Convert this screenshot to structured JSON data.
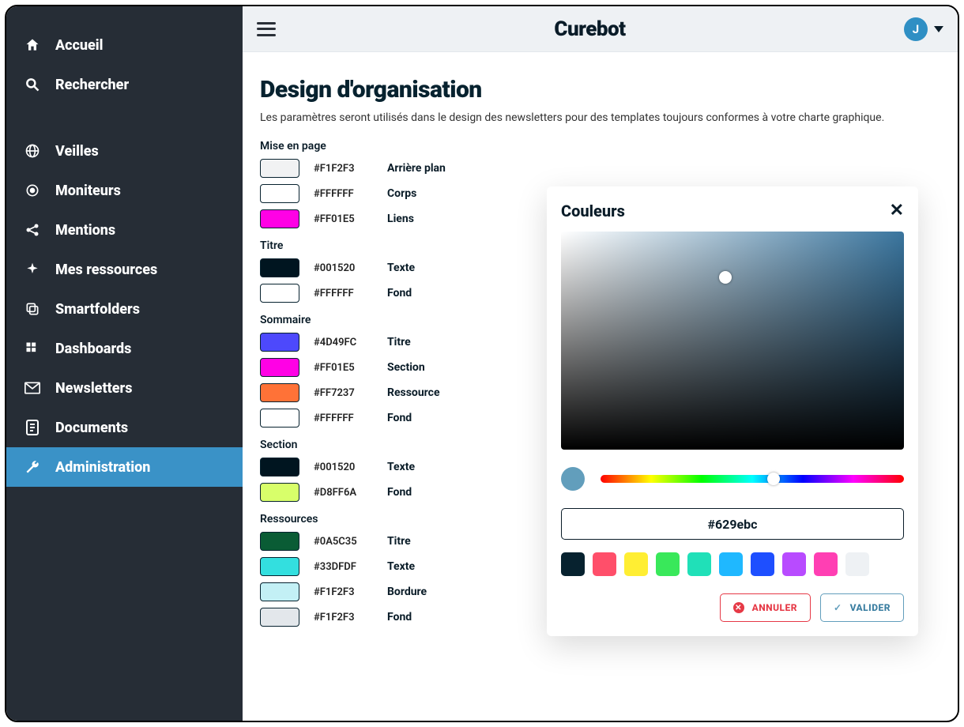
{
  "brand": "Curebot",
  "user_initial": "J",
  "nav": {
    "primary": [
      {
        "id": "home",
        "label": "Accueil"
      },
      {
        "id": "search",
        "label": "Rechercher"
      }
    ],
    "secondary": [
      {
        "id": "veilles",
        "label": "Veilles"
      },
      {
        "id": "moniteurs",
        "label": "Moniteurs"
      },
      {
        "id": "mentions",
        "label": "Mentions"
      },
      {
        "id": "resources",
        "label": "Mes ressources"
      },
      {
        "id": "smartfolders",
        "label": "Smartfolders"
      },
      {
        "id": "dashboards",
        "label": "Dashboards"
      },
      {
        "id": "newsletters",
        "label": "Newsletters"
      },
      {
        "id": "documents",
        "label": "Documents"
      },
      {
        "id": "admin",
        "label": "Administration"
      }
    ]
  },
  "page": {
    "title": "Design d'organisation",
    "subtitle": "Les paramètres seront utilisés dans le design des newsletters pour des templates toujours conformes à votre charte graphique."
  },
  "groups": [
    {
      "title": "Mise en page",
      "rows": [
        {
          "hex": "#F1F2F3",
          "label": "Arrière plan",
          "color": "#F1F2F3"
        },
        {
          "hex": "#FFFFFF",
          "label": "Corps",
          "color": "#FFFFFF"
        },
        {
          "hex": "#FF01E5",
          "label": "Liens",
          "color": "#FF01E5"
        }
      ]
    },
    {
      "title": "Titre",
      "rows": [
        {
          "hex": "#001520",
          "label": "Texte",
          "color": "#001520"
        },
        {
          "hex": "#FFFFFF",
          "label": "Fond",
          "color": "#FFFFFF"
        }
      ]
    },
    {
      "title": "Sommaire",
      "rows": [
        {
          "hex": "#4D49FC",
          "label": "Titre",
          "color": "#4D49FC"
        },
        {
          "hex": "#FF01E5",
          "label": "Section",
          "color": "#FF01E5"
        },
        {
          "hex": "#FF7237",
          "label": "Ressource",
          "color": "#FF7237"
        },
        {
          "hex": "#FFFFFF",
          "label": "Fond",
          "color": "#FFFFFF"
        }
      ]
    },
    {
      "title": "Section",
      "rows": [
        {
          "hex": "#001520",
          "label": "Texte",
          "color": "#001520"
        },
        {
          "hex": "#D8FF6A",
          "label": "Fond",
          "color": "#D8FF6A"
        }
      ]
    },
    {
      "title": "Ressources",
      "rows": [
        {
          "hex": "#0A5C35",
          "label": "Titre",
          "color": "#0A5C35"
        },
        {
          "hex": "#33DFDF",
          "label": "Texte",
          "color": "#33DFDF"
        },
        {
          "hex": "#F1F2F3",
          "label": "Bordure",
          "color": "#C3F0F5"
        },
        {
          "hex": "#F1F2F3",
          "label": "Fond",
          "color": "#E3E7EB"
        }
      ]
    }
  ],
  "picker": {
    "title": "Couleurs",
    "value": "#629ebc",
    "presets": [
      "#07222f",
      "#ff4f6a",
      "#ffee33",
      "#39e85a",
      "#20e0b8",
      "#1fb8ff",
      "#1e4fff",
      "#b84bff",
      "#ff3fb3",
      "#eef1f4"
    ],
    "cancel": "ANNULER",
    "ok": "VALIDER"
  }
}
